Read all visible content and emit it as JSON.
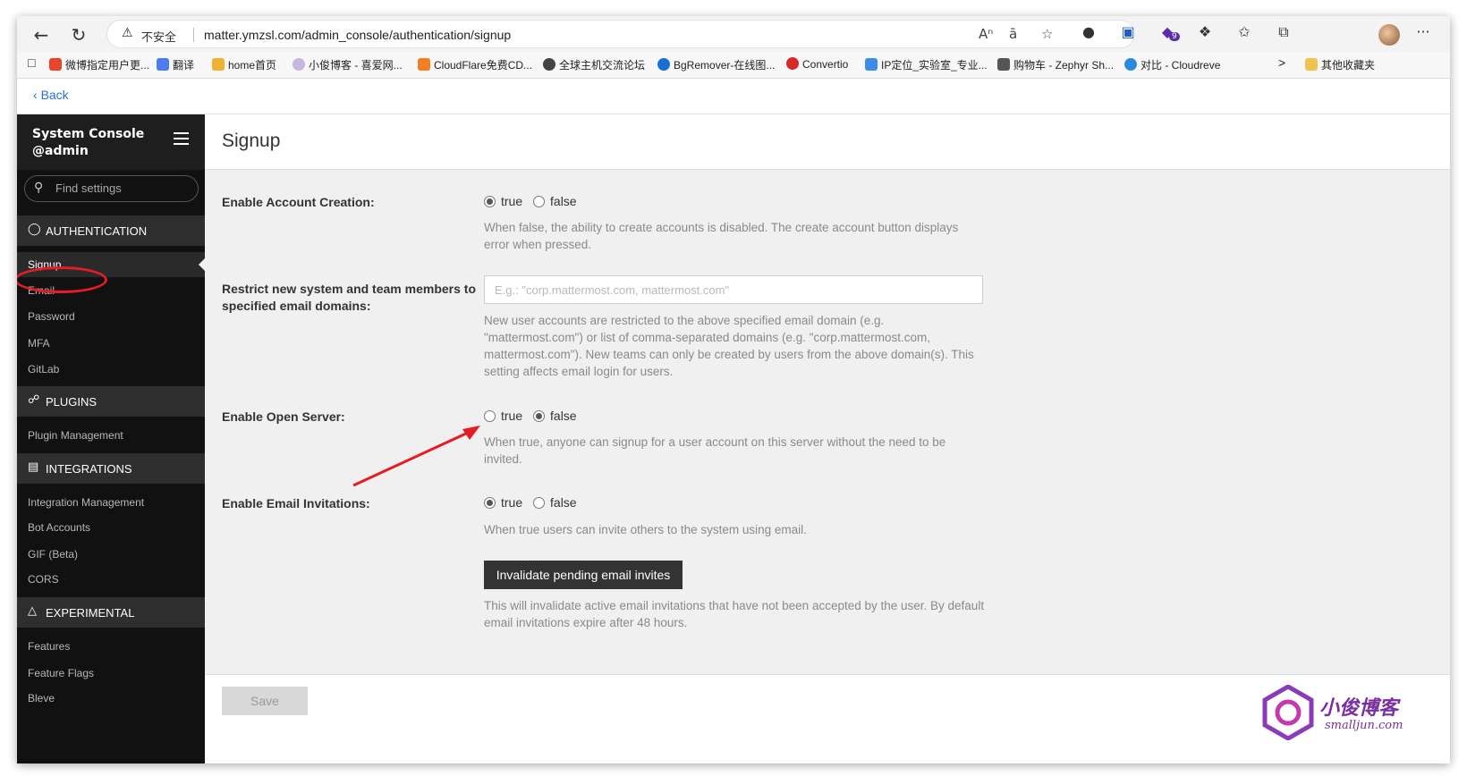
{
  "browser": {
    "insecure_label": "不安全",
    "url": "matter.ymzsl.com/admin_console/authentication/signup",
    "extension_badge": "9",
    "more_menu": "···",
    "bookmarks": [
      "微博指定用户更...",
      "翻译",
      "home首页",
      "小俊博客 - 喜爱网...",
      "CloudFlare免费CD...",
      "全球主机交流论坛",
      "BgRemover-在线图...",
      "Convertio",
      "IP定位_实验室_专业...",
      "购物车 - Zephyr Sh...",
      "对比 - Cloudreve"
    ],
    "bookmark_overflow": ">",
    "other_bookmarks": "其他收藏夹"
  },
  "back": {
    "label": "Back"
  },
  "sidebar": {
    "title": "System Console",
    "user": "@admin",
    "search_placeholder": "Find settings",
    "sections": [
      {
        "label": "AUTHENTICATION",
        "icon": "shield-icon",
        "items": [
          "Signup",
          "Email",
          "Password",
          "MFA",
          "GitLab"
        ]
      },
      {
        "label": "PLUGINS",
        "icon": "plug-icon",
        "items": [
          "Plugin Management"
        ]
      },
      {
        "label": "INTEGRATIONS",
        "icon": "sitemap-icon",
        "items": [
          "Integration Management",
          "Bot Accounts",
          "GIF (Beta)",
          "CORS"
        ]
      },
      {
        "label": "EXPERIMENTAL",
        "icon": "flask-icon",
        "items": [
          "Features",
          "Feature Flags",
          "Bleve"
        ]
      }
    ],
    "active_item": "Signup"
  },
  "page": {
    "title": "Signup",
    "settings": {
      "account_creation": {
        "label": "Enable Account Creation:",
        "true_label": "true",
        "false_label": "false",
        "value": true,
        "help": "When false, the ability to create accounts is disabled. The create account button displays error when pressed."
      },
      "restrict_domains": {
        "label": "Restrict new system and team members to specified email domains:",
        "value": "",
        "placeholder": "E.g.: \"corp.mattermost.com, mattermost.com\"",
        "help": "New user accounts are restricted to the above specified email domain (e.g. \"mattermost.com\") or list of comma-separated domains (e.g. \"corp.mattermost.com, mattermost.com\"). New teams can only be created by users from the above domain(s). This setting affects email login for users."
      },
      "open_server": {
        "label": "Enable Open Server:",
        "true_label": "true",
        "false_label": "false",
        "value": false,
        "help": "When true, anyone can signup for a user account on this server without the need to be invited."
      },
      "email_invitations": {
        "label": "Enable Email Invitations:",
        "true_label": "true",
        "false_label": "false",
        "value": true,
        "help": "When true users can invite others to the system using email."
      },
      "invalidate": {
        "button_label": "Invalidate pending email invites",
        "help": "This will invalidate active email invitations that have not been accepted by the user. By default email invitations expire after 48 hours."
      }
    },
    "save_label": "Save"
  },
  "annotation": {
    "highlight_color": "#e51c23"
  },
  "watermark": {
    "title": "小俊博客",
    "subtitle": "smalljun.com"
  },
  "colors": {
    "sidebar_bg": "#111111",
    "sidebar_section_bg": "#2e2e2e",
    "link": "#2a6ed6",
    "button_dark": "#333333"
  }
}
